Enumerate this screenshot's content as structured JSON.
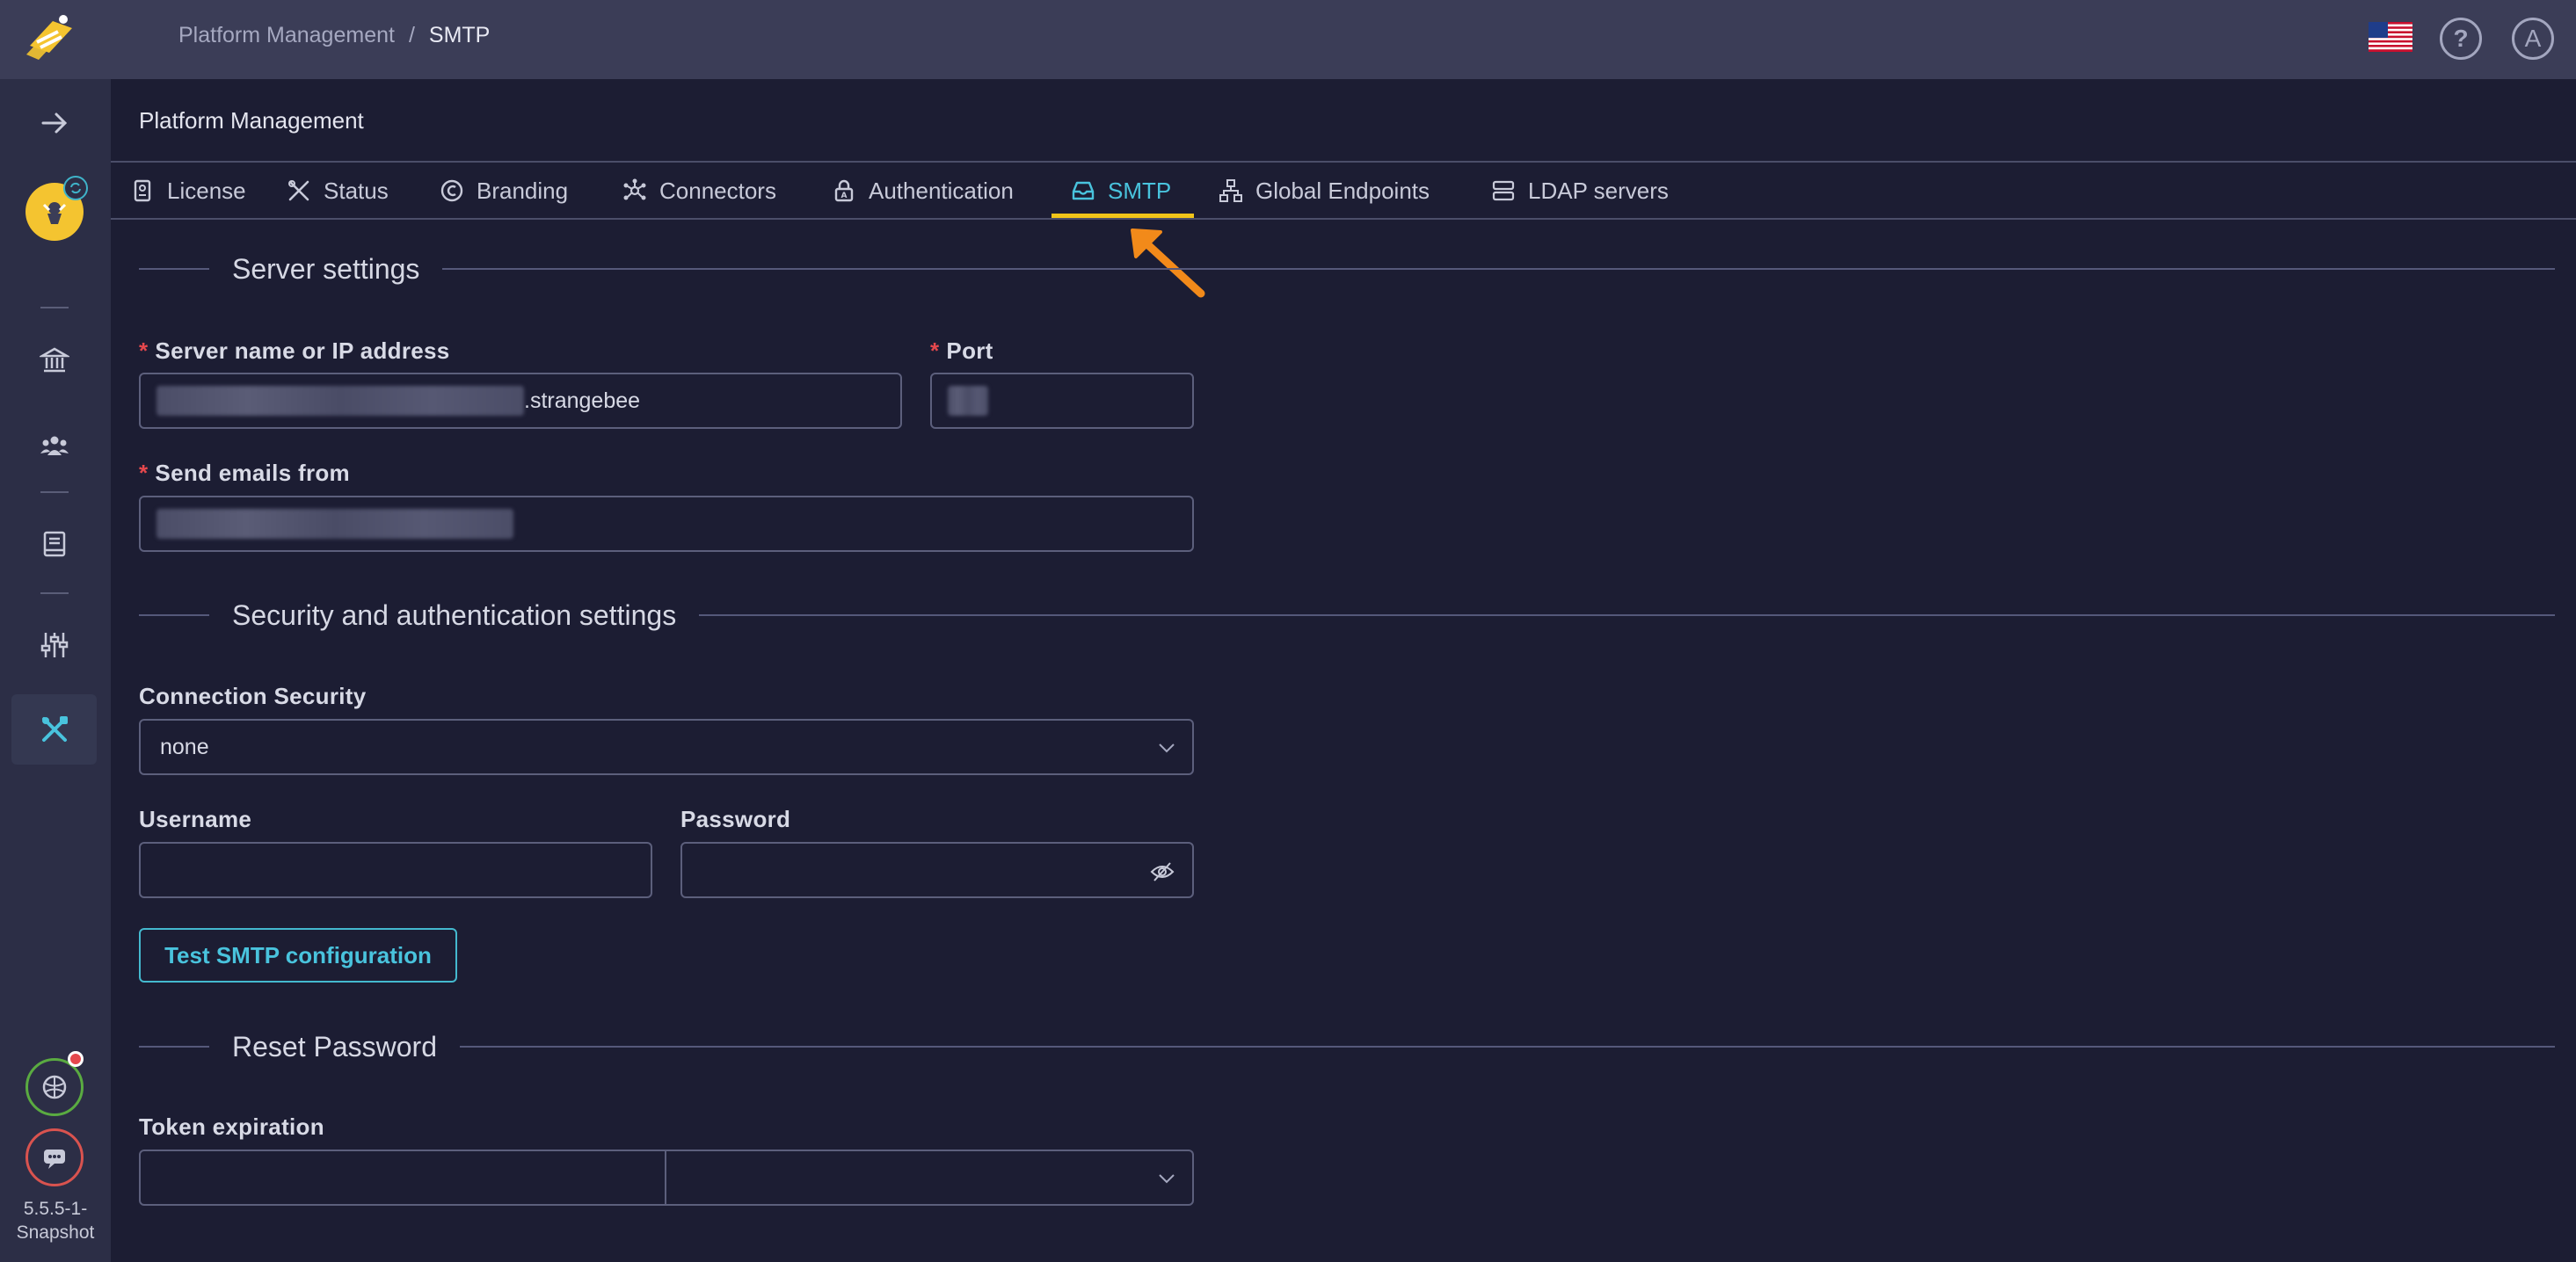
{
  "breadcrumb": {
    "root": "Platform Management",
    "separator": "/",
    "current": "SMTP"
  },
  "header": {
    "help_icon": "?",
    "avatar_initial": "A"
  },
  "page_title": "Platform Management",
  "tabs": [
    {
      "label": "License",
      "icon": "license-icon"
    },
    {
      "label": "Status",
      "icon": "tools-icon"
    },
    {
      "label": "Branding",
      "icon": "copyright-icon"
    },
    {
      "label": "Connectors",
      "icon": "connectors-icon"
    },
    {
      "label": "Authentication",
      "icon": "lock-icon"
    },
    {
      "label": "SMTP",
      "icon": "inbox-icon",
      "active": true
    },
    {
      "label": "Global Endpoints",
      "icon": "network-icon"
    },
    {
      "label": "LDAP servers",
      "icon": "server-icon"
    }
  ],
  "sections": {
    "server": "Server settings",
    "security": "Security and authentication settings",
    "reset": "Reset Password"
  },
  "fields": {
    "server_name": {
      "label": "Server name or IP address",
      "value_suffix": ".strangebee"
    },
    "port": {
      "label": "Port"
    },
    "send_from": {
      "label": "Send emails from"
    },
    "connection_security": {
      "label": "Connection Security",
      "value": "none"
    },
    "username": {
      "label": "Username",
      "value": ""
    },
    "password": {
      "label": "Password",
      "value": ""
    },
    "token_expiration": {
      "label": "Token expiration",
      "value": "",
      "unit": ""
    }
  },
  "buttons": {
    "test_smtp": "Test SMTP configuration"
  },
  "version": {
    "line1": "5.5.5-1-",
    "line2": "Snapshot"
  },
  "colors": {
    "accent": "#49c3dd",
    "active_underline": "#f0c419",
    "required": "#e5484d",
    "arrow": "#f28a1a"
  }
}
